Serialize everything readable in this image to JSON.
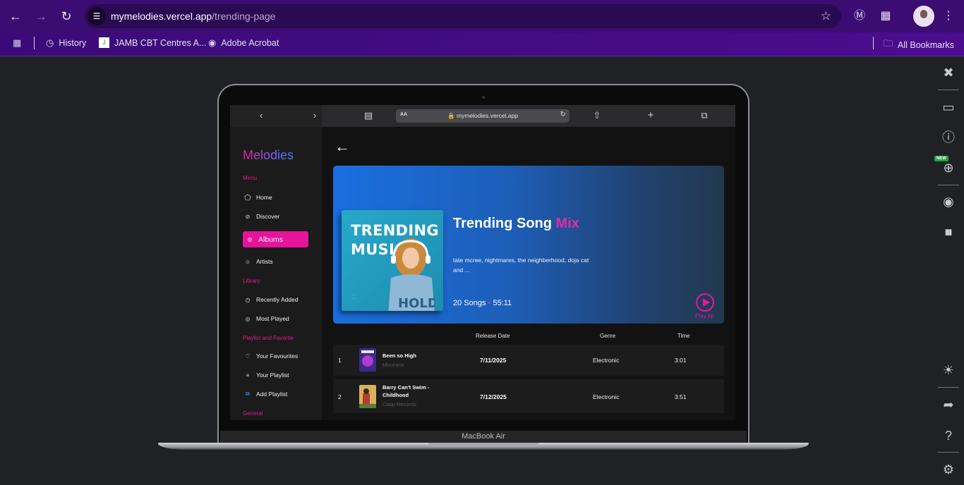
{
  "browser": {
    "url_domain": "mymelodies.vercel.app",
    "url_path": "/trending-page",
    "bookmarks": [
      "History",
      "JAMB CBT Centres A...",
      "Adobe Acrobat"
    ],
    "all_bookmarks": "All Bookmarks"
  },
  "device": {
    "label": "MacBook Air",
    "inner_url": "mymelodies.vercel.app",
    "text_size": "AA"
  },
  "app": {
    "logo": "Melodies",
    "sections": {
      "menu": "Menu",
      "library": "Library",
      "playlist": "Playlist and Favorite",
      "general": "General"
    },
    "nav": {
      "home": "Home",
      "discover": "Discover",
      "albums": "Albums",
      "artists": "Artists",
      "recently_added": "Recently Added",
      "most_played": "Most Played",
      "your_favourites": "Your Favourites",
      "your_playlist": "Your Playlist",
      "add_playlist": "Add Playlist"
    },
    "active_nav": "Albums",
    "accent_color": "#e6139b"
  },
  "hero": {
    "cover_text_line1": "TRENDING",
    "cover_text_line2": "MUSIC",
    "title_main": "Trending Song ",
    "title_accent": "Mix",
    "description": "tate mcree, nightmares, the neighberhood, doja cat and ...",
    "songs": "20 Songs",
    "separator": "•",
    "duration": "55:11",
    "play_label": "Play All"
  },
  "table": {
    "headers": {
      "release": "Release Date",
      "genre": "Genre",
      "time": "Time"
    },
    "rows": [
      {
        "index": "1",
        "title": "Been so High",
        "artist": "Moceans",
        "release": "7/11/2025",
        "genre": "Electronic",
        "time": "3:01"
      },
      {
        "index": "2",
        "title": "Barry Can't Swim - Childhood",
        "artist": "Coop Records",
        "release": "7/12/2025",
        "genre": "Electronic",
        "time": "3:51"
      }
    ]
  },
  "side_panel": {
    "icons": [
      "close-icon",
      "devices-icon",
      "info-icon",
      "zoom-icon",
      "camera-icon",
      "video-icon",
      "brightness-icon",
      "share-icon",
      "help-icon",
      "settings-icon"
    ],
    "new_badge": "NEW"
  }
}
